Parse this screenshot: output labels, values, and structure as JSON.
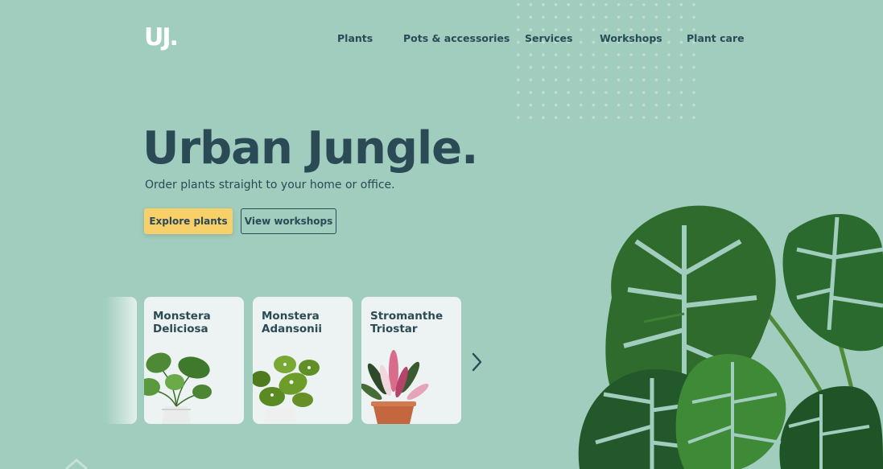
{
  "logo": "UJ.",
  "nav": [
    "Plants",
    "Pots & accessories",
    "Services",
    "Workshops",
    "Plant care"
  ],
  "hero": {
    "title": "Urban Jungle.",
    "subtitle": "Order plants straight to your home or office."
  },
  "buttons": {
    "primary": "Explore plants",
    "secondary": "View workshops"
  },
  "cards": [
    {
      "line1": "Monstera",
      "line2": "Deliciosa"
    },
    {
      "line1": "Monstera",
      "line2": "Adansonii"
    },
    {
      "line1": "Stromanthe",
      "line2": "Triostar"
    }
  ],
  "colors": {
    "background": "#a0cdbd",
    "text": "#2a4a56",
    "accent": "#f8d06a",
    "card": "#ecf3f2"
  },
  "icons": {
    "next": "chevron-right-icon"
  }
}
